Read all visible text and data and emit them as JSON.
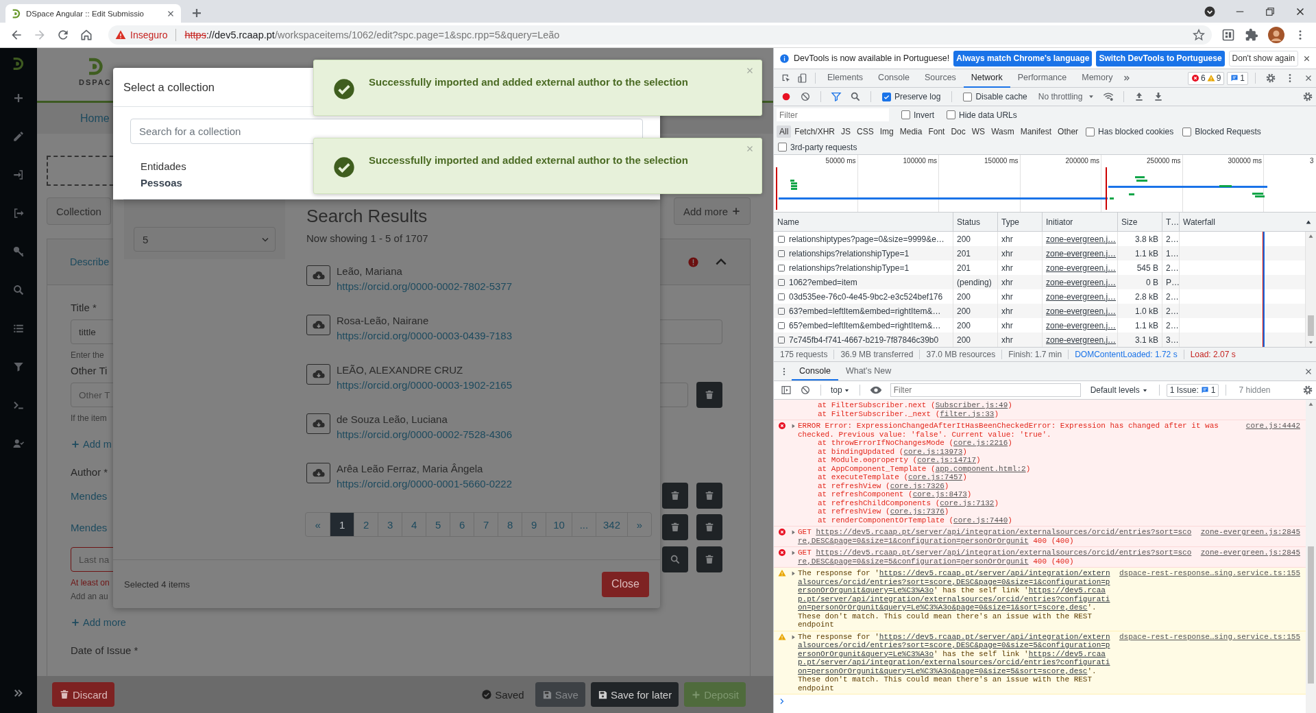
{
  "browser": {
    "tab_title": "DSpace Angular :: Edit Submissio",
    "security_label": "Inseguro",
    "url": {
      "scheme": "https",
      "host": "://dev5.rcaap.pt",
      "path": "/workspaceitems/1062/edit?spc.page=1&spc.rpp=5&query=Leão"
    }
  },
  "app": {
    "logo_text": "DSPAC",
    "nav_item": "Home",
    "collection_button": "Collection",
    "add_more_button": "Add more",
    "section": {
      "title": "Describe",
      "has_error": true,
      "expanded": true
    },
    "rows": [
      {
        "kind": "label",
        "text": "Title *"
      },
      {
        "kind": "input",
        "value": "tittle",
        "invalid": false
      },
      {
        "kind": "hint",
        "text": "Enter the"
      },
      {
        "kind": "label",
        "text": "Other Ti"
      },
      {
        "kind": "input",
        "placeholder": "Other T",
        "invalid": false,
        "actions": [
          {
            "kind": "delete"
          }
        ]
      },
      {
        "kind": "hint",
        "text": "If the item"
      },
      {
        "kind": "add",
        "text": "Add m"
      },
      {
        "kind": "label",
        "text": "Author *"
      },
      {
        "kind": "value",
        "text": "Mendes",
        "actions": [
          {
            "kind": "delete"
          },
          {
            "kind": "delete"
          }
        ]
      },
      {
        "kind": "value",
        "text": "Mendes",
        "actions": [
          {
            "kind": "delete"
          },
          {
            "kind": "delete"
          }
        ]
      },
      {
        "kind": "input",
        "placeholder": "Last na",
        "invalid": true,
        "actions": [
          {
            "kind": "search"
          },
          {
            "kind": "delete"
          }
        ]
      },
      {
        "kind": "error",
        "text": "At least on"
      },
      {
        "kind": "hint",
        "text": "Add an au"
      },
      {
        "kind": "add",
        "text": "Add more"
      },
      {
        "kind": "label",
        "text": "Date of Issue *"
      }
    ],
    "footer": {
      "discard": "Discard",
      "status": "Saved",
      "actions": [
        {
          "label": "Save",
          "kind": "save",
          "disabled": true
        },
        {
          "label": "Save for later",
          "kind": "save",
          "disabled": false
        },
        {
          "label": "Deposit",
          "kind": "deposit",
          "disabled": true
        }
      ]
    }
  },
  "lookup_modal": {
    "results_per_page": "5",
    "heading": "Search Results",
    "showing": "Now showing 1 - 5 of 1707",
    "results": [
      {
        "name": "Leão, Mariana",
        "link": "https://orcid.org/0000-0002-7802-5377"
      },
      {
        "name": "Rosa-Leão, Nairane",
        "link": "https://orcid.org/0000-0003-0439-7183"
      },
      {
        "name": "LEÃO, ALEXANDRE CRUZ",
        "link": "https://orcid.org/0000-0003-1902-2165"
      },
      {
        "name": "de Souza Leão, Luciana",
        "link": "https://orcid.org/0000-0002-7528-4306"
      },
      {
        "name": "Arêa Leão Ferraz, Maria Ângela",
        "link": "https://orcid.org/0000-0001-5660-0222"
      }
    ],
    "pagination": [
      {
        "label": "«",
        "selected": false
      },
      {
        "label": "1",
        "selected": true
      },
      {
        "label": "2",
        "selected": false
      },
      {
        "label": "3",
        "selected": false
      },
      {
        "label": "4",
        "selected": false
      },
      {
        "label": "5",
        "selected": false
      },
      {
        "label": "6",
        "selected": false
      },
      {
        "label": "7",
        "selected": false
      },
      {
        "label": "8",
        "selected": false
      },
      {
        "label": "9",
        "selected": false
      },
      {
        "label": "10",
        "selected": false
      },
      {
        "label": "...",
        "selected": false
      },
      {
        "label": "342",
        "selected": false
      },
      {
        "label": "»",
        "selected": false
      }
    ],
    "selected_info": "Selected 4 items",
    "close": "Close"
  },
  "collection_modal": {
    "title": "Select a collection",
    "search_placeholder": "Search for a collection",
    "entries": [
      {
        "label": "Entidades",
        "kind": "community"
      },
      {
        "label": "Pessoas",
        "kind": "collection"
      }
    ]
  },
  "toasts": [
    {
      "message": "Successfully imported and added external author to the selection"
    },
    {
      "message": "Successfully imported and added external author to the selection"
    }
  ],
  "devtools": {
    "infobar": {
      "message": "DevTools is now available in Portuguese!",
      "buttons": [
        {
          "label": "Always match Chrome's language",
          "kind": "primary"
        },
        {
          "label": "Switch DevTools to Portuguese",
          "kind": "primary"
        },
        {
          "label": "Don't show again",
          "kind": "secondary"
        }
      ]
    },
    "tabs": [
      {
        "label": "Elements",
        "selected": false
      },
      {
        "label": "Console",
        "selected": false
      },
      {
        "label": "Sources",
        "selected": false
      },
      {
        "label": "Network",
        "selected": true
      },
      {
        "label": "Performance",
        "selected": false
      },
      {
        "label": "Memory",
        "selected": false
      }
    ],
    "counts": {
      "errors": "6",
      "warnings": "9",
      "messages": "1"
    },
    "network_toolbar": {
      "preserve_log": {
        "label": "Preserve log",
        "checked": true
      },
      "disable_cache": {
        "label": "Disable cache",
        "checked": false
      },
      "throttling": "No throttling"
    },
    "filter": {
      "placeholder": "Filter",
      "options": [
        {
          "label": "Invert",
          "checked": false
        },
        {
          "label": "Hide data URLs",
          "checked": false
        }
      ]
    },
    "types": [
      {
        "label": "All",
        "selected": true
      },
      {
        "label": "Fetch/XHR",
        "selected": false
      },
      {
        "label": "JS",
        "selected": false
      },
      {
        "label": "CSS",
        "selected": false
      },
      {
        "label": "Img",
        "selected": false
      },
      {
        "label": "Media",
        "selected": false
      },
      {
        "label": "Font",
        "selected": false
      },
      {
        "label": "Doc",
        "selected": false
      },
      {
        "label": "WS",
        "selected": false
      },
      {
        "label": "Wasm",
        "selected": false
      },
      {
        "label": "Manifest",
        "selected": false
      },
      {
        "label": "Other",
        "selected": false
      }
    ],
    "type_options": [
      {
        "label": "Has blocked cookies",
        "checked": false
      },
      {
        "label": "Blocked Requests",
        "checked": false
      }
    ],
    "third_party": {
      "label": "3rd-party requests",
      "checked": false
    },
    "overview_ticks": [
      "50000 ms",
      "100000 ms",
      "150000 ms",
      "200000 ms",
      "250000 ms",
      "300000 ms",
      "3"
    ],
    "columns": [
      "Name",
      "Status",
      "Type",
      "Initiator",
      "Size",
      "T…",
      "Waterfall"
    ],
    "requests": [
      {
        "name": "relationshiptypes?page=0&size=9999&e…",
        "status": "200",
        "type": "xhr",
        "initiator": "zone-evergreen.j…",
        "size": "3.8 kB",
        "time": "2…"
      },
      {
        "name": "relationships?relationshipType=1",
        "status": "201",
        "type": "xhr",
        "initiator": "zone-evergreen.j…",
        "size": "1.1 kB",
        "time": "1…"
      },
      {
        "name": "relationships?relationshipType=1",
        "status": "201",
        "type": "xhr",
        "initiator": "zone-evergreen.j…",
        "size": "545 B",
        "time": "2…"
      },
      {
        "name": "1062?embed=item",
        "status": "(pending)",
        "type": "xhr",
        "initiator": "zone-evergreen.j…",
        "size": "0 B",
        "time": "P…"
      },
      {
        "name": "03d535ee-76c0-4e45-9bc2-e3c524bef176",
        "status": "200",
        "type": "xhr",
        "initiator": "zone-evergreen.j…",
        "size": "2.8 kB",
        "time": "2…"
      },
      {
        "name": "63?embed=leftItem&embed=rightItem&…",
        "status": "200",
        "type": "xhr",
        "initiator": "zone-evergreen.j…",
        "size": "1.0 kB",
        "time": "2…"
      },
      {
        "name": "65?embed=leftItem&embed=rightItem&…",
        "status": "200",
        "type": "xhr",
        "initiator": "zone-evergreen.j…",
        "size": "1.1 kB",
        "time": "2…"
      },
      {
        "name": "7c745fb4-f741-4667-b219-7f87846c39b0",
        "status": "200",
        "type": "xhr",
        "initiator": "zone-evergreen.j…",
        "size": "3.1 kB",
        "time": "3…"
      }
    ],
    "summary": [
      {
        "text": "175 requests",
        "kind": "plain"
      },
      {
        "text": "36.9 MB transferred",
        "kind": "plain"
      },
      {
        "text": "37.0 MB resources",
        "kind": "plain"
      },
      {
        "text": "Finish: 1.7 min",
        "kind": "plain"
      },
      {
        "text": "DOMContentLoaded: 1.72 s",
        "kind": "dom"
      },
      {
        "text": "Load: 2.07 s",
        "kind": "load"
      }
    ],
    "drawer_tabs": [
      {
        "label": "Console",
        "selected": true
      },
      {
        "label": "What's New",
        "selected": false
      }
    ],
    "console_toolbar": {
      "context": "top",
      "filter_placeholder": "Filter",
      "levels": "Default levels",
      "issues_label": "1 Issue:",
      "issues_count": "1",
      "hidden": "7 hidden"
    },
    "messages": [
      {
        "kind": "error",
        "continued": true,
        "stack": [
          {
            "call": "at FilterSubscriber.next (",
            "src": "Subscriber.js:49",
            "tail": ")"
          },
          {
            "call": "at FilterSubscriber._next (",
            "src": "filter.js:33",
            "tail": ")"
          }
        ]
      },
      {
        "kind": "error",
        "continued": false,
        "parts": [
          {
            "kind": "text",
            "text": "ERROR Error: ExpressionChangedAfterItHasBeenCheckedError: Expression has changed after it was checked. Previous value: 'false'. Current value: 'true'."
          }
        ],
        "source": "core.js:4442",
        "stack": [
          {
            "call": "at throwErrorIfNoChangesMode (",
            "src": "core.js:2216",
            "tail": ")"
          },
          {
            "call": "at bindingUpdated (",
            "src": "core.js:13973",
            "tail": ")"
          },
          {
            "call": "at Module.ɵɵproperty (",
            "src": "core.js:14717",
            "tail": ")"
          },
          {
            "call": "at AppComponent_Template (",
            "src": "app.component.html:2",
            "tail": ")"
          },
          {
            "call": "at executeTemplate (",
            "src": "core.js:7457",
            "tail": ")"
          },
          {
            "call": "at refreshView (",
            "src": "core.js:7326",
            "tail": ")"
          },
          {
            "call": "at refreshComponent (",
            "src": "core.js:8473",
            "tail": ")"
          },
          {
            "call": "at refreshChildComponents (",
            "src": "core.js:7132",
            "tail": ")"
          },
          {
            "call": "at refreshView (",
            "src": "core.js:7376",
            "tail": ")"
          },
          {
            "call": "at renderComponentOrTemplate (",
            "src": "core.js:7440",
            "tail": ")"
          }
        ]
      },
      {
        "kind": "error",
        "continued": false,
        "parts": [
          {
            "kind": "text",
            "text": "GET "
          },
          {
            "kind": "link",
            "text": "https://dev5.rcaap.pt/server/api/integration/externalsources/orcid/entries?sort=score,DESC&page=0&size=1&configuration=personOrOrgunit"
          },
          {
            "kind": "text",
            "text": " 400 (400)"
          }
        ],
        "source": "zone-evergreen.js:2845"
      },
      {
        "kind": "error",
        "continued": false,
        "parts": [
          {
            "kind": "text",
            "text": "GET "
          },
          {
            "kind": "link",
            "text": "https://dev5.rcaap.pt/server/api/integration/externalsources/orcid/entries?sort=score,DESC&page=0&size=5&configuration=personOrOrgunit"
          },
          {
            "kind": "text",
            "text": " 400 (400)"
          }
        ],
        "source": "zone-evergreen.js:2845"
      },
      {
        "kind": "warning",
        "continued": false,
        "parts": [
          {
            "kind": "text",
            "text": "The response for '"
          },
          {
            "kind": "link",
            "text": "https://dev5.rcaap.pt/server/api/integration/externalsources/orcid/entries?sort=score,DESC&page=0&size=1&configuration=personOrOrgunit&query=Le%C3%A3o"
          },
          {
            "kind": "text",
            "text": "' has the self link '"
          },
          {
            "kind": "link",
            "text": "https://dev5.rcaap.pt/server/api/integration/externalsources/orcid/entries?configuration=personOrOrgunit&query=Le%C3%A3o&page=0&size=1&sort=score,desc"
          },
          {
            "kind": "text",
            "text": "'. These don't match. This could mean there's an issue with the REST endpoint"
          }
        ],
        "source": "dspace-rest-response…sing.service.ts:155"
      },
      {
        "kind": "warning",
        "continued": false,
        "parts": [
          {
            "kind": "text",
            "text": "The response for '"
          },
          {
            "kind": "link",
            "text": "https://dev5.rcaap.pt/server/api/integration/externalsources/orcid/entries?sort=score,DESC&page=0&size=5&configuration=personOrOrgunit&query=Le%C3%A3o"
          },
          {
            "kind": "text",
            "text": "' has the self link '"
          },
          {
            "kind": "link",
            "text": "https://dev5.rcaap.pt/server/api/integration/externalsources/orcid/entries?configuration=personOrOrgunit&query=Le%C3%A3o&page=0&size=5&sort=score,desc"
          },
          {
            "kind": "text",
            "text": "'. These don't match. This could mean there's an issue with the REST endpoint"
          }
        ],
        "source": "dspace-rest-response…sing.service.ts:155"
      }
    ]
  }
}
